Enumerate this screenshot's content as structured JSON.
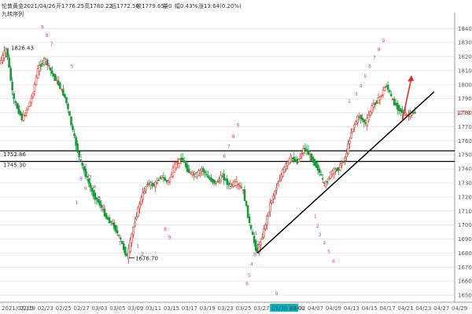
{
  "header": {
    "instrument": "伦敦黄金",
    "date": "2021/04/26",
    "open": "开1776.25",
    "high": "高1780.22",
    "low": "低1772.56",
    "close": "收1779.65",
    "volume": "量0",
    "change_pct": "幅0.43%",
    "change": "涨13.64(0.20%)",
    "indicator": "九转序列"
  },
  "colors": {
    "up": "#d6342b",
    "down": "#1a9a3a",
    "grid": "#e6e6e6",
    "mark": "#cc33cc",
    "trend": "#000000",
    "arrow": "#e8262a",
    "last_price": "#d6342b",
    "date_highlight_bg": "#00b3c8"
  },
  "chart_data": {
    "type": "candlestick",
    "ylim": [
      1645,
      1848
    ],
    "y_ticks": [
      1650,
      1660,
      1670,
      1680,
      1690,
      1700,
      1710,
      1720,
      1730,
      1740,
      1750,
      1760,
      1770,
      1780,
      1790,
      1800,
      1810,
      1820,
      1830,
      1840
    ],
    "x_labels": [
      "2021/02/15",
      "02/19",
      "02/23",
      "02/25",
      "02/27",
      "03/03",
      "03/05",
      "03/09",
      "03/11",
      "03/15",
      "03/17",
      "03/19",
      "03/23",
      "03/25",
      "03/27",
      "03/30 22:00",
      "04/02",
      "04/07",
      "04/09",
      "04/13",
      "04/15",
      "04/17",
      "04/21",
      "04/23",
      "04/27",
      "04/29"
    ],
    "highlight_x_label": "03/30 22:00",
    "last_price": "1779.65",
    "price_labels": [
      {
        "text": "1826.43",
        "value": 1826.43
      },
      {
        "text": "1676.70",
        "value": 1676.7
      },
      {
        "text": "1752.86",
        "value": 1752.86
      },
      {
        "text": "1745.30",
        "value": 1745.3
      }
    ],
    "horizontal_levels": [
      1752.86,
      1745.3
    ],
    "trendline": {
      "from": {
        "x": 0.566,
        "y": 1680
      },
      "to": {
        "x": 0.955,
        "y": 1795
      }
    },
    "path_points": [
      [
        0.0,
        1815
      ],
      [
        0.015,
        1826
      ],
      [
        0.03,
        1790
      ],
      [
        0.05,
        1775
      ],
      [
        0.07,
        1790
      ],
      [
        0.085,
        1812
      ],
      [
        0.1,
        1818
      ],
      [
        0.115,
        1808
      ],
      [
        0.13,
        1800
      ],
      [
        0.145,
        1790
      ],
      [
        0.16,
        1768
      ],
      [
        0.175,
        1748
      ],
      [
        0.19,
        1735
      ],
      [
        0.205,
        1722
      ],
      [
        0.22,
        1715
      ],
      [
        0.235,
        1705
      ],
      [
        0.25,
        1700
      ],
      [
        0.265,
        1690
      ],
      [
        0.28,
        1677
      ],
      [
        0.295,
        1700
      ],
      [
        0.31,
        1718
      ],
      [
        0.325,
        1730
      ],
      [
        0.34,
        1728
      ],
      [
        0.355,
        1735
      ],
      [
        0.37,
        1730
      ],
      [
        0.385,
        1742
      ],
      [
        0.4,
        1748
      ],
      [
        0.415,
        1738
      ],
      [
        0.43,
        1735
      ],
      [
        0.445,
        1740
      ],
      [
        0.46,
        1733
      ],
      [
        0.475,
        1730
      ],
      [
        0.49,
        1735
      ],
      [
        0.505,
        1728
      ],
      [
        0.52,
        1730
      ],
      [
        0.535,
        1725
      ],
      [
        0.55,
        1700
      ],
      [
        0.566,
        1680
      ],
      [
        0.58,
        1695
      ],
      [
        0.595,
        1715
      ],
      [
        0.61,
        1728
      ],
      [
        0.625,
        1740
      ],
      [
        0.64,
        1748
      ],
      [
        0.655,
        1745
      ],
      [
        0.67,
        1755
      ],
      [
        0.685,
        1748
      ],
      [
        0.7,
        1740
      ],
      [
        0.715,
        1728
      ],
      [
        0.73,
        1738
      ],
      [
        0.745,
        1740
      ],
      [
        0.76,
        1748
      ],
      [
        0.775,
        1768
      ],
      [
        0.79,
        1778
      ],
      [
        0.805,
        1772
      ],
      [
        0.82,
        1785
      ],
      [
        0.835,
        1790
      ],
      [
        0.85,
        1800
      ],
      [
        0.865,
        1788
      ],
      [
        0.88,
        1782
      ],
      [
        0.895,
        1778
      ],
      [
        0.91,
        1780
      ]
    ],
    "nine_marks": [
      {
        "text": "9",
        "x": 0.09,
        "y": 1840
      },
      {
        "text": "8",
        "x": 0.1,
        "y": 1834
      },
      {
        "text": "7",
        "x": 0.11,
        "y": 1828
      },
      {
        "text": "5",
        "x": 0.155,
        "y": 1812
      },
      {
        "text": "1",
        "x": 0.175,
        "y": 1748
      },
      {
        "text": "2",
        "x": 0.185,
        "y": 1741
      },
      {
        "text": "3",
        "x": 0.195,
        "y": 1733
      },
      {
        "text": "4",
        "x": 0.205,
        "y": 1726
      },
      {
        "text": "5",
        "x": 0.215,
        "y": 1718
      },
      {
        "text": "6",
        "x": 0.225,
        "y": 1712
      },
      {
        "text": "9",
        "x": 0.185,
        "y": 1725
      },
      {
        "text": "8",
        "x": 0.175,
        "y": 1732
      },
      {
        "text": "1",
        "x": 0.165,
        "y": 1715
      },
      {
        "text": "1",
        "x": 0.26,
        "y": 1686
      },
      {
        "text": "1",
        "x": 0.3,
        "y": 1684
      },
      {
        "text": "2",
        "x": 0.31,
        "y": 1678
      },
      {
        "text": "9",
        "x": 0.37,
        "y": 1690
      },
      {
        "text": "8",
        "x": 0.36,
        "y": 1696
      },
      {
        "text": "9",
        "x": 0.52,
        "y": 1770
      },
      {
        "text": "8",
        "x": 0.51,
        "y": 1762
      },
      {
        "text": "7",
        "x": 0.5,
        "y": 1755
      },
      {
        "text": "6",
        "x": 0.49,
        "y": 1748
      },
      {
        "text": "1",
        "x": 0.56,
        "y": 1693
      },
      {
        "text": "2",
        "x": 0.565,
        "y": 1686
      },
      {
        "text": "3",
        "x": 0.555,
        "y": 1678
      },
      {
        "text": "4",
        "x": 0.55,
        "y": 1671
      },
      {
        "text": "5",
        "x": 0.545,
        "y": 1663
      },
      {
        "text": "6",
        "x": 0.54,
        "y": 1657
      },
      {
        "text": "9",
        "x": 0.605,
        "y": 1650
      },
      {
        "text": "1",
        "x": 0.69,
        "y": 1705
      },
      {
        "text": "2",
        "x": 0.695,
        "y": 1698
      },
      {
        "text": "3",
        "x": 0.7,
        "y": 1692
      },
      {
        "text": "4",
        "x": 0.71,
        "y": 1686
      },
      {
        "text": "5",
        "x": 0.72,
        "y": 1680
      },
      {
        "text": "6",
        "x": 0.73,
        "y": 1673
      },
      {
        "text": "9",
        "x": 0.84,
        "y": 1830
      },
      {
        "text": "8",
        "x": 0.83,
        "y": 1824
      },
      {
        "text": "7",
        "x": 0.82,
        "y": 1818
      },
      {
        "text": "6",
        "x": 0.81,
        "y": 1812
      },
      {
        "text": "5",
        "x": 0.8,
        "y": 1805
      },
      {
        "text": "4",
        "x": 0.79,
        "y": 1798
      },
      {
        "text": "3",
        "x": 0.78,
        "y": 1792
      },
      {
        "text": "1",
        "x": 0.765,
        "y": 1787
      }
    ]
  }
}
